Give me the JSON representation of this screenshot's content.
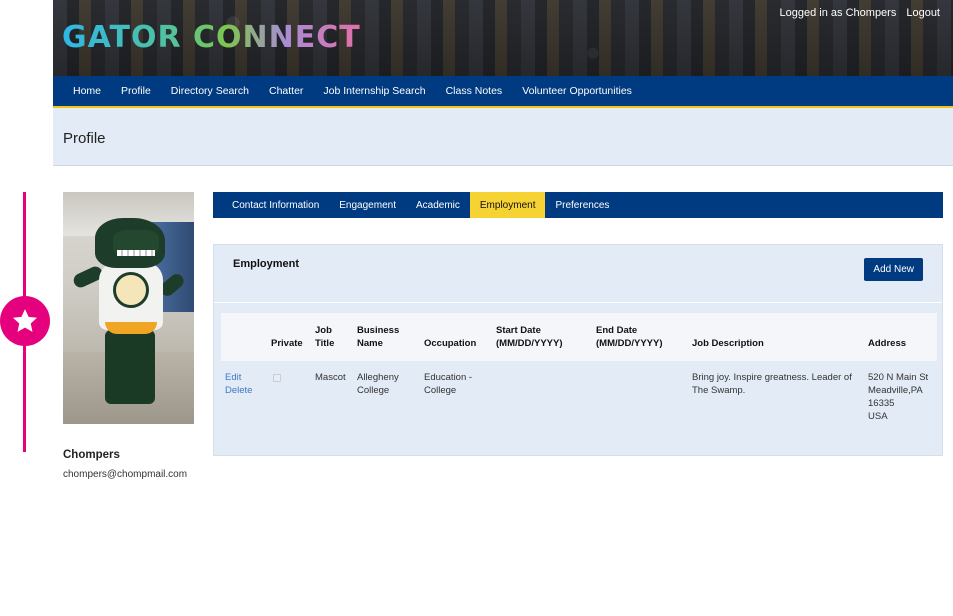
{
  "header": {
    "logo_text": "GATOR CONNECT",
    "logged_in_text": "Logged in as Chompers",
    "logout_label": "Logout"
  },
  "main_nav": {
    "items": [
      "Home",
      "Profile",
      "Directory Search",
      "Chatter",
      "Job Internship Search",
      "Class Notes",
      "Volunteer Opportunities"
    ]
  },
  "page": {
    "title": "Profile"
  },
  "profile": {
    "name": "Chompers",
    "email": "chompers@chompmail.com"
  },
  "tabs": {
    "items": [
      "Contact Information",
      "Engagement",
      "Academic",
      "Employment",
      "Preferences"
    ],
    "active": "Employment"
  },
  "employment": {
    "title": "Employment",
    "add_label": "Add New",
    "columns": {
      "private": "Private",
      "job_title": [
        "Job",
        "Title"
      ],
      "business_name": [
        "Business",
        "Name"
      ],
      "occupation": "Occupation",
      "start_date": [
        "Start Date",
        "(MM/DD/YYYY)"
      ],
      "end_date": [
        "End Date",
        "(MM/DD/YYYY)"
      ],
      "job_description": "Job Description",
      "address": "Address"
    },
    "rows": [
      {
        "edit_label": "Edit",
        "delete_label": "Delete",
        "private": false,
        "job_title": "Mascot",
        "business_name": [
          "Allegheny",
          "College"
        ],
        "occupation": [
          "Education -",
          "College"
        ],
        "start_date": "",
        "end_date": "",
        "job_description": [
          "Bring joy. Inspire greatness. Leader of",
          "The Swamp."
        ],
        "address": [
          "520 N Main St",
          "Meadville,PA",
          "16335",
          "USA"
        ]
      }
    ]
  },
  "colors": {
    "nav_blue": "#003a80",
    "active_tab": "#f7d233",
    "panel_bg": "#e3ebf6",
    "accent_pink": "#e5007d",
    "link_blue": "#3d79c6"
  },
  "icons": {
    "accent": "star-icon"
  }
}
